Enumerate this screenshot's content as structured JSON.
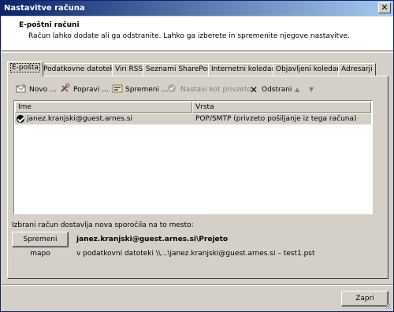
{
  "window": {
    "title": "Nastavitve računa",
    "close_glyph": "✕"
  },
  "header": {
    "title": "E-poštni računi",
    "description": "Račun lahko dodate ali ga odstranite. Lahko ga izberete in spremenite njegove nastavitve."
  },
  "tabs": [
    {
      "label": "E-pošta",
      "active": true
    },
    {
      "label": "Podatkovne datoteke",
      "active": false
    },
    {
      "label": "Viri RSS",
      "active": false
    },
    {
      "label": "Seznami SharePoint",
      "active": false
    },
    {
      "label": "Internetni koledarji",
      "active": false
    },
    {
      "label": "Objavljeni koledarji",
      "active": false
    },
    {
      "label": "Adresarji",
      "active": false
    }
  ],
  "toolbar": {
    "new_label": "Novo ...",
    "repair_label": "Popravi ...",
    "change_label": "Spremeni ...",
    "default_label": "Nastavi kot privzeto",
    "remove_label": "Odstrani",
    "up_glyph": "▲",
    "down_glyph": "▼"
  },
  "accounts_table": {
    "columns": [
      "Ime",
      "Vrsta"
    ],
    "rows": [
      {
        "name": "janez.kranjski@guest.arnes.si",
        "type": "POP/SMTP (privzeto pošiljanje iz tega računa)",
        "selected": true,
        "default": true
      }
    ]
  },
  "delivery": {
    "label": "Izbrani račun dostavlja nova sporočila na to mesto:",
    "change_folder_button": "Spremeni mapo",
    "folder": "janez.kranjski@guest.arnes.si\\Prejeto",
    "data_file": "v podatkovni datoteki \\\\...\\janez.kranjski@guest.arnes.si – test1.pst"
  },
  "footer": {
    "close_button": "Zapri"
  },
  "colors": {
    "title_start": "#0a246a",
    "title_end": "#a6caf0",
    "face": "#d4d0c8",
    "selection": "#d4d0c8"
  }
}
